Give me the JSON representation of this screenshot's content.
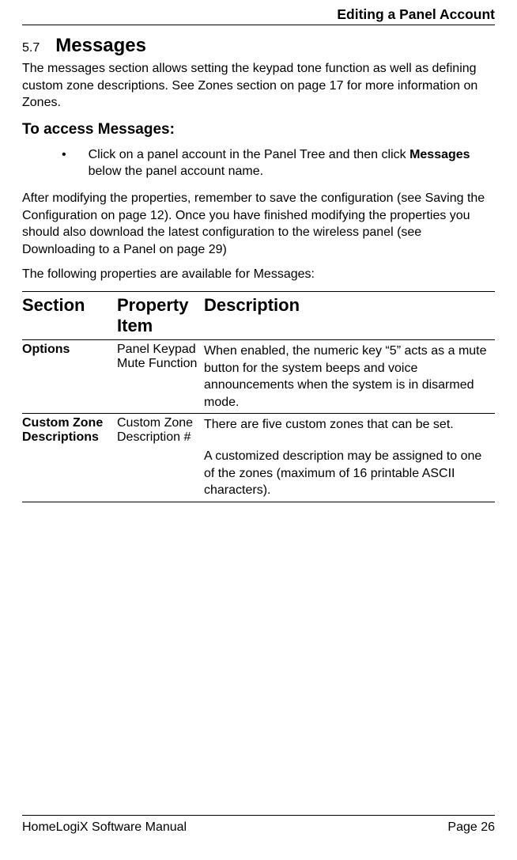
{
  "header": {
    "title": "Editing a Panel Account"
  },
  "section": {
    "number": "5.7",
    "title": "Messages",
    "intro": "The messages section allows setting the keypad tone function as well as defining custom zone descriptions. See Zones section on page 17 for more information on Zones.",
    "sub_heading": "To access Messages:",
    "bullet_prefix": "Click on a panel account in the Panel Tree and then click ",
    "bullet_bold": "Messages",
    "bullet_suffix": " below the panel account name.",
    "after_note": "After modifying the properties, remember to save the configuration (see Saving the Configuration  on page 12). Once you have finished modifying the properties you should also download the latest configuration to the wireless panel (see Downloading to a Panel  on page 29)",
    "following": "The following properties are available for Messages:"
  },
  "table": {
    "headers": {
      "section": "Section",
      "property": "Property Item",
      "description": "Description"
    },
    "rows": [
      {
        "section": "Options",
        "property": "Panel Keypad Mute Function",
        "description_1": "When enabled, the numeric key “5” acts as a mute button for the system beeps and voice announcements when the system is in disarmed mode.",
        "description_2": ""
      },
      {
        "section": "Custom Zone Descriptions",
        "property": "Custom Zone Description #",
        "description_1": "There are five custom zones that can be set.",
        "description_2": "A customized description may be assigned to one of the zones (maximum of 16 printable ASCII characters)."
      }
    ]
  },
  "footer": {
    "left": "HomeLogiX Software Manual",
    "right": "Page 26"
  }
}
